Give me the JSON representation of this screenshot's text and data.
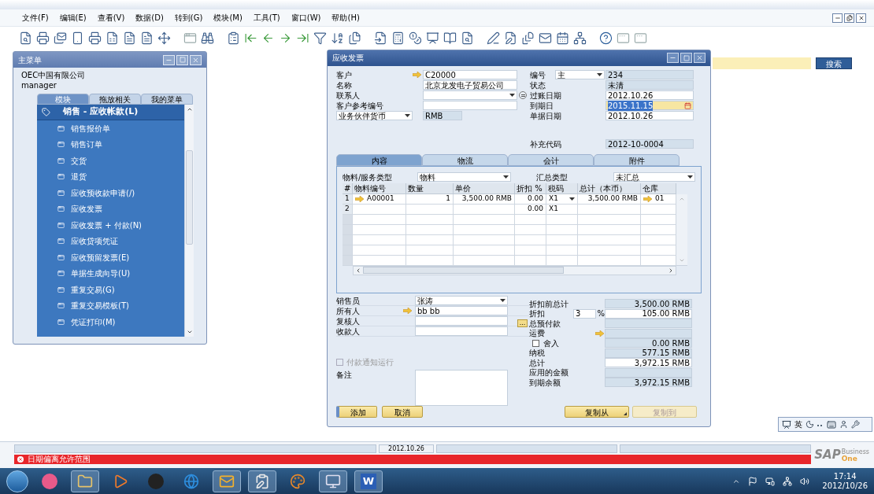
{
  "menu_bar": [
    "文件(F)",
    "编辑(E)",
    "查看(V)",
    "数据(D)",
    "转到(G)",
    "模块(M)",
    "工具(T)",
    "窗口(W)",
    "帮助(H)"
  ],
  "search": {
    "button": "搜索"
  },
  "main_menu": {
    "title": "主菜单",
    "company": "OEC中国有限公司",
    "user": "manager",
    "tabs": [
      {
        "label": "模块",
        "selected": true
      },
      {
        "label": "拖放相关",
        "selected": false
      },
      {
        "label": "我的菜单",
        "selected": false
      }
    ],
    "section": "销售 - 应收帐款(L)",
    "items": [
      "销售报价单",
      "销售订单",
      "交货",
      "退货",
      "应收预收款申请(/)",
      "应收发票",
      "应收发票 + 付款(N)",
      "应收贷项凭证",
      "应收预留发票(E)",
      "单据生成向导(U)",
      "重复交易(G)",
      "重复交易模板(T)",
      "凭证打印(M)"
    ]
  },
  "invoice": {
    "title": "应收发票",
    "header_left": [
      {
        "label": "客户",
        "value": "C20000",
        "readonly": false,
        "link": true
      },
      {
        "label": "名称",
        "value": "北京龙发电子贸易公司",
        "readonly": false
      },
      {
        "label": "联系人",
        "readonly": false,
        "dropdown": true,
        "detail_button": true
      },
      {
        "label": "客户参考编号",
        "readonly": false
      },
      {
        "label": "业务伙伴货币",
        "label_dropdown": true,
        "value": "RMB",
        "readonly": true
      }
    ],
    "header_right": [
      {
        "label": "编号",
        "series": "主",
        "value": "234",
        "readonly": true
      },
      {
        "label": "状态",
        "value": "未清",
        "readonly": true
      },
      {
        "label": "过账日期",
        "value": "2012.10.26",
        "readonly": false
      },
      {
        "label": "到期日",
        "value": "2015.11.15",
        "readonly": false,
        "focused": true
      },
      {
        "label": "单据日期",
        "value": "2012.10.26",
        "readonly": false
      }
    ],
    "supplement": {
      "label": "补充代码",
      "value": "2012-10-0004",
      "readonly": true
    },
    "tabs": [
      {
        "label": "内容",
        "selected": true
      },
      {
        "label": "物流",
        "selected": false
      },
      {
        "label": "会计",
        "selected": false
      },
      {
        "label": "附件",
        "selected": false
      }
    ],
    "item_type": {
      "label": "物料/服务类型",
      "value": "物料"
    },
    "summary_type": {
      "label": "汇总类型",
      "value": "未汇总"
    },
    "table": {
      "columns": [
        "#",
        "物料编号",
        "数量",
        "单价",
        "折扣 %",
        "税码",
        "总计（本币）",
        "仓库"
      ],
      "rows": [
        {
          "cells": [
            "1",
            "A00001",
            "1",
            "3,500.00 RMB",
            "0.00",
            "X1",
            "3,500.00 RMB",
            "01"
          ],
          "link_item": true,
          "link_warehouse": true,
          "tax_dropdown": true
        },
        {
          "cells": [
            "2",
            null,
            null,
            null,
            "0.00",
            "X1",
            null,
            null
          ],
          "link_item": false,
          "link_warehouse": false,
          "tax_dropdown": false
        }
      ]
    },
    "footer_left": [
      {
        "label": "销售员",
        "value": "张涛",
        "readonly": false,
        "dropdown": true
      },
      {
        "label": "所有人",
        "value": "bb bb",
        "readonly": false,
        "link": true
      },
      {
        "label": "复核人",
        "readonly": false
      },
      {
        "label": "收款人",
        "readonly": false
      }
    ],
    "payment_notice": {
      "label": "付款通知运行",
      "checked": false,
      "disabled": true
    },
    "remarks": {
      "label": "备注"
    },
    "totals": [
      {
        "kind": "plain",
        "label": "折扣前总计",
        "value": "3,500.00 RMB",
        "readonly": true
      },
      {
        "kind": "percent",
        "label": "折扣",
        "percent": "3",
        "unit": "%",
        "value": "105.00 RMB",
        "readonly": false
      },
      {
        "kind": "detail",
        "label": "总预付款",
        "button": "...",
        "readonly": true
      },
      {
        "kind": "link",
        "label": "运费",
        "readonly": true
      },
      {
        "kind": "checkbox",
        "label": "舍入",
        "checked": false,
        "value": "0.00 RMB",
        "readonly": true
      },
      {
        "kind": "plain",
        "label": "纳税",
        "value": "577.15 RMB",
        "readonly": true
      },
      {
        "kind": "plain",
        "label": "总计",
        "value": "3,972.15 RMB",
        "readonly": false
      },
      {
        "kind": "plain",
        "label": "应用的金额",
        "readonly": true
      },
      {
        "kind": "plain",
        "label": "到期余额",
        "value": "3,972.15 RMB",
        "readonly": true
      }
    ],
    "buttons": [
      {
        "label": "添加",
        "default": true,
        "disabled": false,
        "menu": false
      },
      {
        "label": "取消",
        "default": false,
        "disabled": false,
        "menu": false
      },
      {
        "label": "复制从",
        "default": false,
        "disabled": false,
        "menu": true
      },
      {
        "label": "复制到",
        "default": false,
        "disabled": true,
        "menu": false
      }
    ]
  },
  "language_bar": {
    "label": "英"
  },
  "status_bar": {
    "date": "2012.10.26",
    "message": "日期偏离允许范围",
    "error": true
  },
  "brand": {
    "name": "SAP",
    "line1": "Business",
    "line2": "One"
  },
  "taskbar": {
    "word_glyph": "W",
    "time": "17:14",
    "date": "2012/10/26"
  }
}
